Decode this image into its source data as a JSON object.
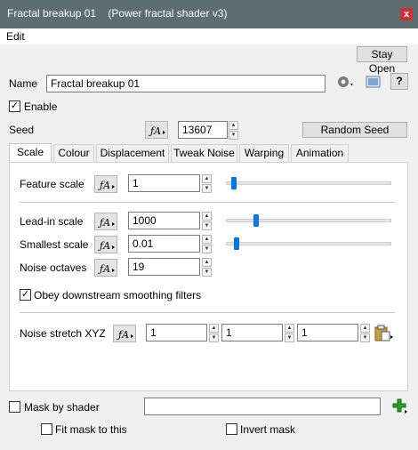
{
  "window": {
    "title": "Fractal breakup 01",
    "subtitle": "(Power fractal shader v3)",
    "close": "x"
  },
  "menu": {
    "edit": "Edit"
  },
  "toolbar": {
    "stay_open": "Stay Open"
  },
  "name": {
    "label": "Name",
    "value": "Fractal breakup 01"
  },
  "enable": {
    "label": "Enable",
    "checked": true
  },
  "seed": {
    "label": "Seed",
    "value": "13607",
    "random_label": "Random Seed"
  },
  "tabs": [
    "Scale",
    "Colour",
    "Displacement",
    "Tweak Noise",
    "Warping",
    "Animation"
  ],
  "active_tab": "Scale",
  "scale": {
    "feature_scale": {
      "label": "Feature scale",
      "value": "1",
      "slider_fraction": 0.04
    },
    "lead_in_scale": {
      "label": "Lead-in scale",
      "value": "1000",
      "slider_fraction": 0.18
    },
    "smallest_scale": {
      "label": "Smallest scale",
      "value": "0.01",
      "slider_fraction": 0.04
    },
    "noise_octaves": {
      "label": "Noise octaves",
      "value": "19"
    },
    "obey_smoothing": {
      "label": "Obey downstream smoothing filters",
      "checked": true
    },
    "noise_stretch": {
      "label": "Noise stretch XYZ",
      "x": "1",
      "y": "1",
      "z": "1"
    }
  },
  "mask": {
    "label": "Mask by shader",
    "value": "",
    "checked": false,
    "fit_label": "Fit mask to this",
    "fit_checked": false,
    "invert_label": "Invert mask",
    "invert_checked": false
  },
  "colors": {
    "titlebar": "#5e6c74",
    "slider_thumb": "#0a74d8",
    "close": "#c8333a"
  }
}
